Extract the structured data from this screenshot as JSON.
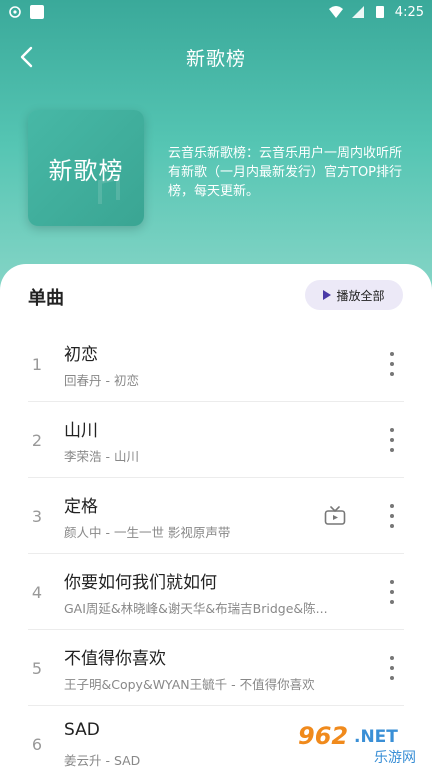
{
  "status_bar": {
    "time": "4:25"
  },
  "topbar": {
    "title": "新歌榜"
  },
  "cover": {
    "text": "新歌榜"
  },
  "description": "云音乐新歌榜：云音乐用户一周内收听所有新歌（一月内最新发行）官方TOP排行榜，每天更新。",
  "section": {
    "title": "单曲",
    "play_all_label": "播放全部"
  },
  "songs": [
    {
      "index": "1",
      "name": "初恋",
      "artist": "回春丹 - 初恋",
      "mv": false
    },
    {
      "index": "2",
      "name": "山川",
      "artist": "李荣浩 - 山川",
      "mv": false
    },
    {
      "index": "3",
      "name": "定格",
      "artist": "颜人中 - 一生一世 影视原声带",
      "mv": true
    },
    {
      "index": "4",
      "name": "你要如何我们就如何",
      "artist": "GAI周延&林晓峰&谢天华&布瑞吉Bridge&陈...",
      "mv": false
    },
    {
      "index": "5",
      "name": "不值得你喜欢",
      "artist": "王子明&Copy&WYAN王毓千 - 不值得你喜欢",
      "mv": false
    },
    {
      "index": "6",
      "name": "SAD",
      "artist": "姜云升 - SAD",
      "mv": false
    }
  ],
  "watermark": {
    "text": "962.NET 乐游网"
  },
  "colors": {
    "accent": "#4cbfae",
    "play_icon": "#4a3aa8"
  }
}
